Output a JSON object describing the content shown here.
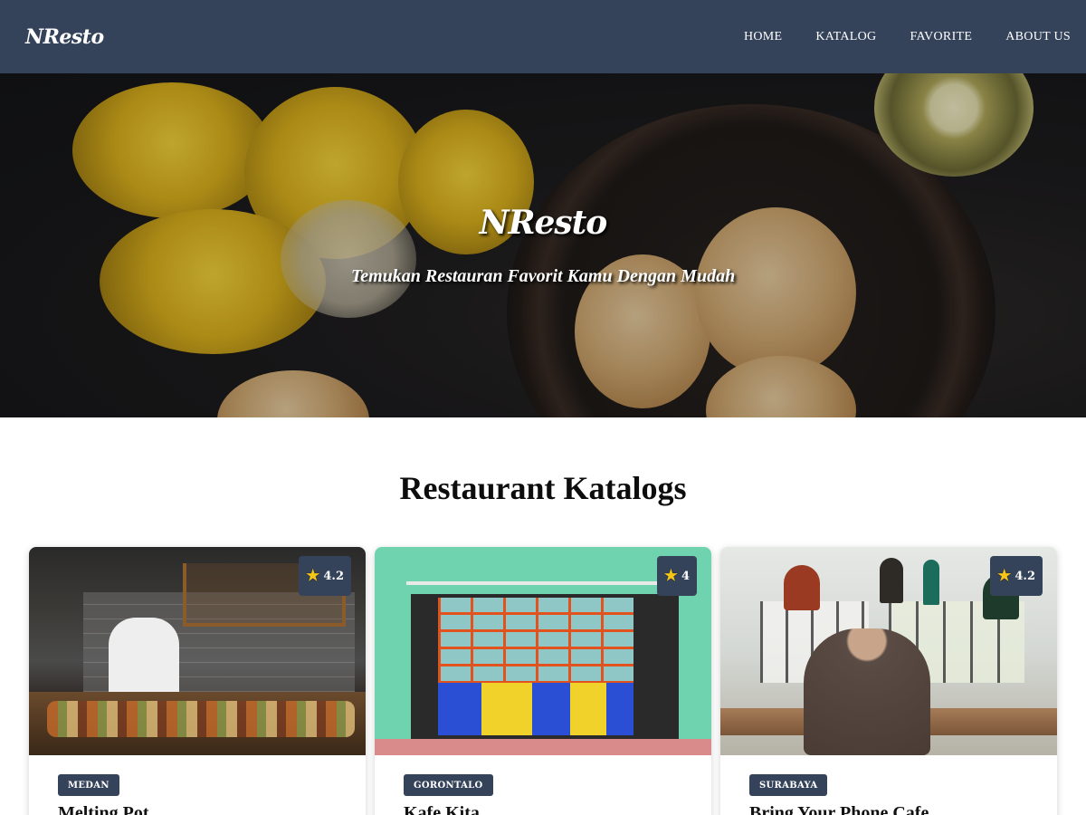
{
  "navbar": {
    "brand": "NResto",
    "links": [
      "HOME",
      "KATALOG",
      "FAVORITE",
      "ABOUT US"
    ]
  },
  "hero": {
    "title": "NResto",
    "subtitle": "Temukan Restauran Favorit Kamu Dengan Mudah"
  },
  "catalog": {
    "title": "Restaurant Katalogs",
    "restaurants": [
      {
        "name": "Melting Pot",
        "city": "MEDAN",
        "rating": "4.2"
      },
      {
        "name": "Kafe Kita",
        "city": "GORONTALO",
        "rating": "4"
      },
      {
        "name": "Bring Your Phone Cafe",
        "city": "SURABAYA",
        "rating": "4.2"
      }
    ]
  },
  "icons": {
    "rating": "star-icon"
  },
  "colors": {
    "primary": "#34425a",
    "star": "#f5c518"
  }
}
